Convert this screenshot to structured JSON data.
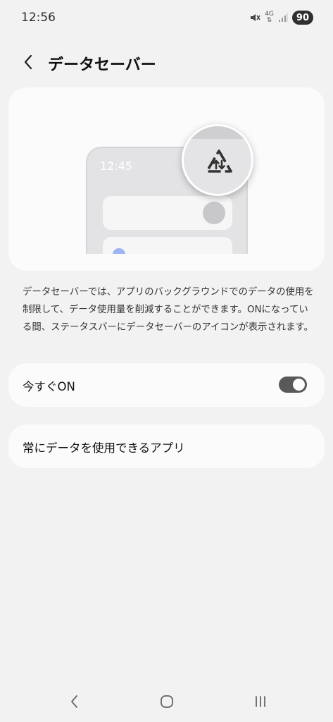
{
  "status_bar": {
    "time": "12:56",
    "network": "4G",
    "battery": "90"
  },
  "header": {
    "title": "データセーバー"
  },
  "illustration": {
    "mock_time": "12:45"
  },
  "description": "データセーバーでは、アプリのバックグラウンドでのデータの使用を制限して、データ使用量を削減することができます。ONになっている間、ステータスバーにデータセーバーのアイコンが表示されます。",
  "settings": {
    "turn_on_now": {
      "label": "今すぐON",
      "enabled": true
    },
    "unrestricted_apps": {
      "label": "常にデータを使用できるアプリ"
    }
  },
  "colors": {
    "background": "#f2f2f2",
    "card": "#fbfbfb",
    "toggle_on": "#595959",
    "accent_dot": "#9ab4f5"
  }
}
